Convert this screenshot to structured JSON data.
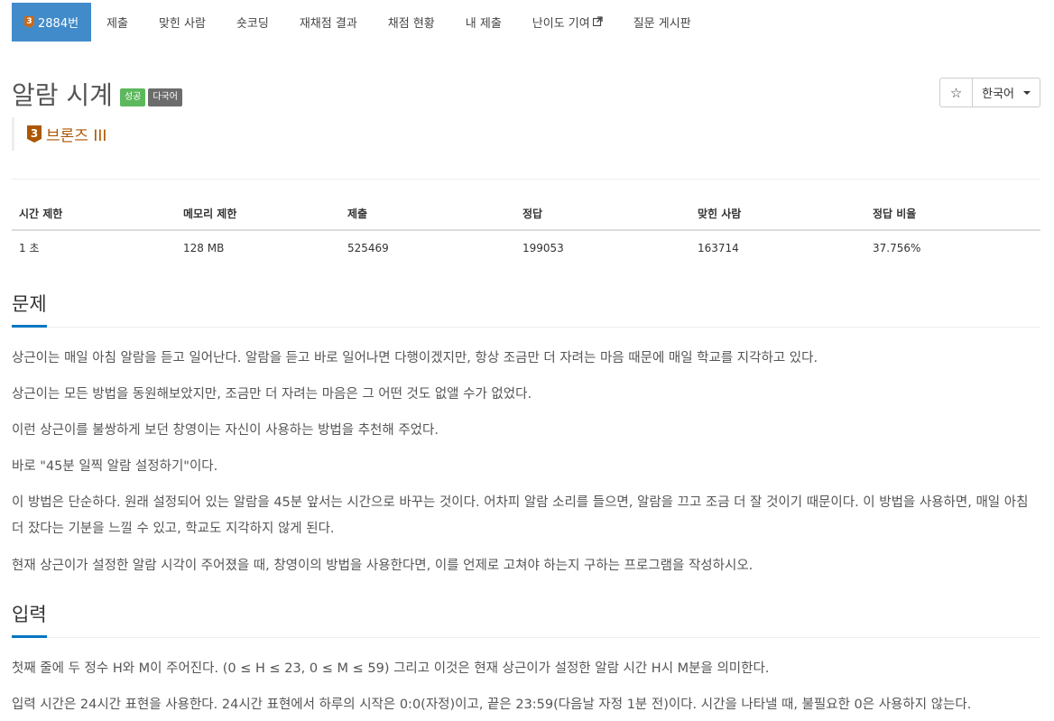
{
  "nav": {
    "problem_id": "2884번",
    "tier_num": "3",
    "tabs": [
      "제출",
      "맞힌 사람",
      "숏코딩",
      "재채점 결과",
      "채점 현황",
      "내 제출",
      "난이도 기여",
      "질문 게시판"
    ]
  },
  "problem": {
    "title": "알람 시계",
    "labels": [
      "성공",
      "다국어"
    ],
    "tier_num": "3",
    "tier_name": "브론즈 III"
  },
  "controls": {
    "star_icon": "star-icon",
    "language": "한국어"
  },
  "info_table": {
    "headers": [
      "시간 제한",
      "메모리 제한",
      "제출",
      "정답",
      "맞힌 사람",
      "정답 비율"
    ],
    "values": [
      "1 초",
      "128 MB",
      "525469",
      "199053",
      "163714",
      "37.756%"
    ]
  },
  "sections": {
    "problem_title": "문제",
    "problem_paragraphs": [
      "상근이는 매일 아침 알람을 듣고 일어난다. 알람을 듣고 바로 일어나면 다행이겠지만, 항상 조금만 더 자려는 마음 때문에 매일 학교를 지각하고 있다.",
      "상근이는 모든 방법을 동원해보았지만, 조금만 더 자려는 마음은 그 어떤 것도 없앨 수가 없었다.",
      "이런 상근이를 불쌍하게 보던 창영이는 자신이 사용하는 방법을 추천해 주었다.",
      "바로 \"45분 일찍 알람 설정하기\"이다.",
      "이 방법은 단순하다. 원래 설정되어 있는 알람을 45분 앞서는 시간으로 바꾸는 것이다. 어차피 알람 소리를 들으면, 알람을 끄고 조금 더 잘 것이기 때문이다. 이 방법을 사용하면, 매일 아침 더 잤다는 기분을 느낄 수 있고, 학교도 지각하지 않게 된다.",
      "현재 상근이가 설정한 알람 시각이 주어졌을 때, 창영이의 방법을 사용한다면, 이를 언제로 고쳐야 하는지 구하는 프로그램을 작성하시오."
    ],
    "input_title": "입력",
    "input_paragraphs": [
      "첫째 줄에 두 정수 H와 M이 주어진다. (0 ≤ H ≤ 23, 0 ≤ M ≤ 59) 그리고 이것은 현재 상근이가 설정한 알람 시간 H시 M분을 의미한다.",
      "입력 시간은 24시간 표현을 사용한다. 24시간 표현에서 하루의 시작은 0:0(자정)이고, 끝은 23:59(다음날 자정 1분 전)이다. 시간을 나타낼 때, 불필요한 0은 사용하지 않는다."
    ]
  }
}
